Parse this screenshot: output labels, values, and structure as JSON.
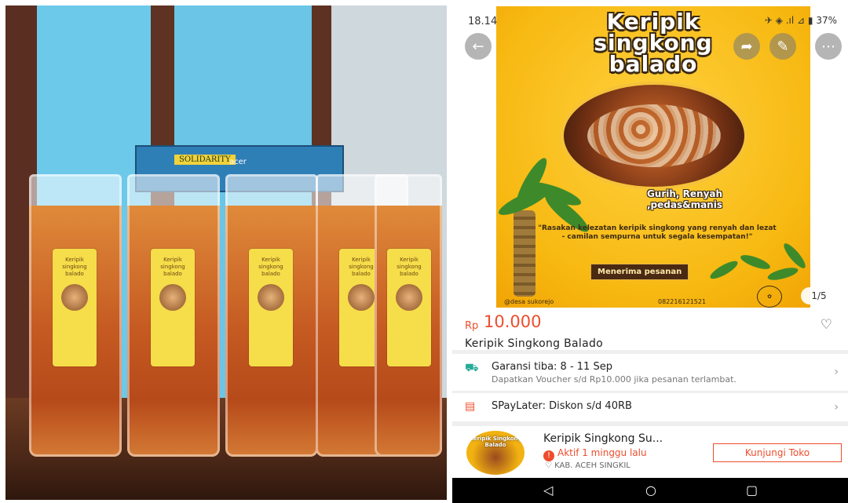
{
  "photo": {
    "box_label": "SOLIDARITY",
    "box_brand": "acer",
    "bag_label_text": "Keripik singkong balado"
  },
  "status_bar": {
    "time": "18.14",
    "icons": "✈ ◈ .ıl ⊿ ▮ 37%"
  },
  "banner": {
    "title_lines": [
      "Keripik",
      "singkong",
      "balado"
    ],
    "tagline": "Gurih, Renyah ,pedas&manis",
    "quote": "\"Rasakan kelezatan keripik singkong yang renyah dan lezat - camilan sempurna untuk segala kesempatan!\"",
    "cta": "Menerima pesanan",
    "instagram": "@desa sukorejo",
    "whatsapp": "082216121521",
    "counter": "1/5"
  },
  "product": {
    "currency": "Rp",
    "price": "10.000",
    "name": "Keripik Singkong Balado"
  },
  "shipping": {
    "title": "Garansi tiba: 8 - 11 Sep",
    "subtitle": "Dapatkan Voucher s/d Rp10.000 jika pesanan terlambat."
  },
  "paylater": {
    "text": "SPayLater: Diskon s/d 40RB"
  },
  "shop": {
    "name": "Keripik Singkong Su...",
    "status": "Aktif 1 minggu lalu",
    "location": "KAB. ACEH SINGKIL",
    "visit_label": "Kunjungi Toko",
    "avatar_text": "Keripik Singkong Balado"
  },
  "icons": {
    "back": "back-arrow-icon",
    "share": "share-icon",
    "edit": "edit-icon",
    "more": "more-icon",
    "heart": "heart-icon",
    "truck": "truck-icon",
    "wallet": "wallet-icon",
    "location": "location-pin-icon"
  },
  "colors": {
    "accent": "#ee4d2d",
    "banner_yellow": "#f7b811"
  }
}
